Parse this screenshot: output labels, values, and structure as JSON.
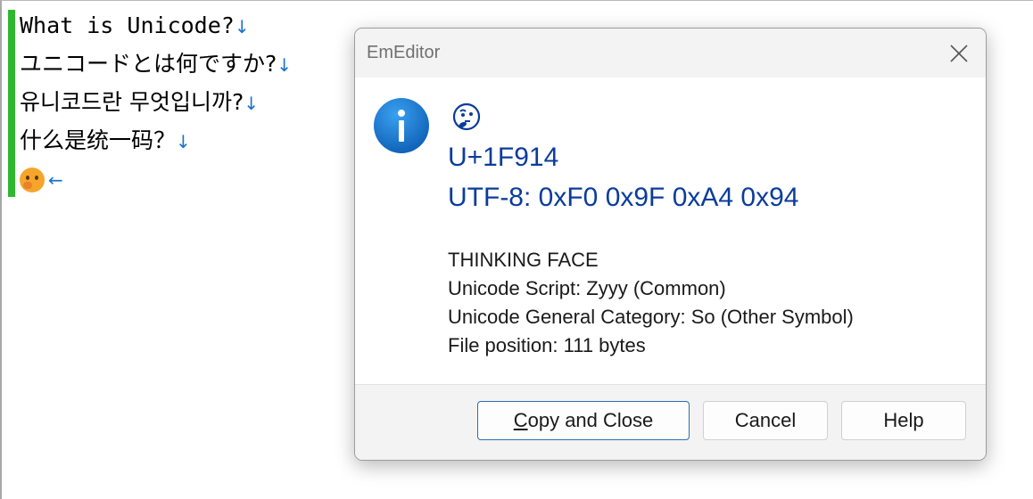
{
  "editor": {
    "lines": [
      {
        "text": "What is Unicode?",
        "eol": "↓"
      },
      {
        "text": "ユニコードとは何ですか?",
        "eol": "↓"
      },
      {
        "text": "유니코드란 무엇입니까?",
        "eol": "↓"
      },
      {
        "text": "什么是统一码？",
        "eol": "↓"
      },
      {
        "emoji": "thinking-face-emoji",
        "eol": "←"
      }
    ],
    "modified_bar_color": "#2fb82f",
    "eol_color": "#1a73c8"
  },
  "dialog": {
    "title": "EmEditor",
    "icon": "info-icon",
    "glyph": "thinking-face-emoji",
    "codepoint": "U+1F914",
    "utf8": "UTF-8: 0xF0 0x9F 0xA4 0x94",
    "details": [
      "THINKING FACE",
      "Unicode Script: Zyyy (Common)",
      "Unicode General Category: So (Other Symbol)",
      "File position: 111 bytes"
    ],
    "buttons": {
      "copy_close": "Copy and Close",
      "cancel": "Cancel",
      "help": "Help"
    },
    "accent_color": "#0b3c9b",
    "info_icon_color": "#1a78d2"
  }
}
